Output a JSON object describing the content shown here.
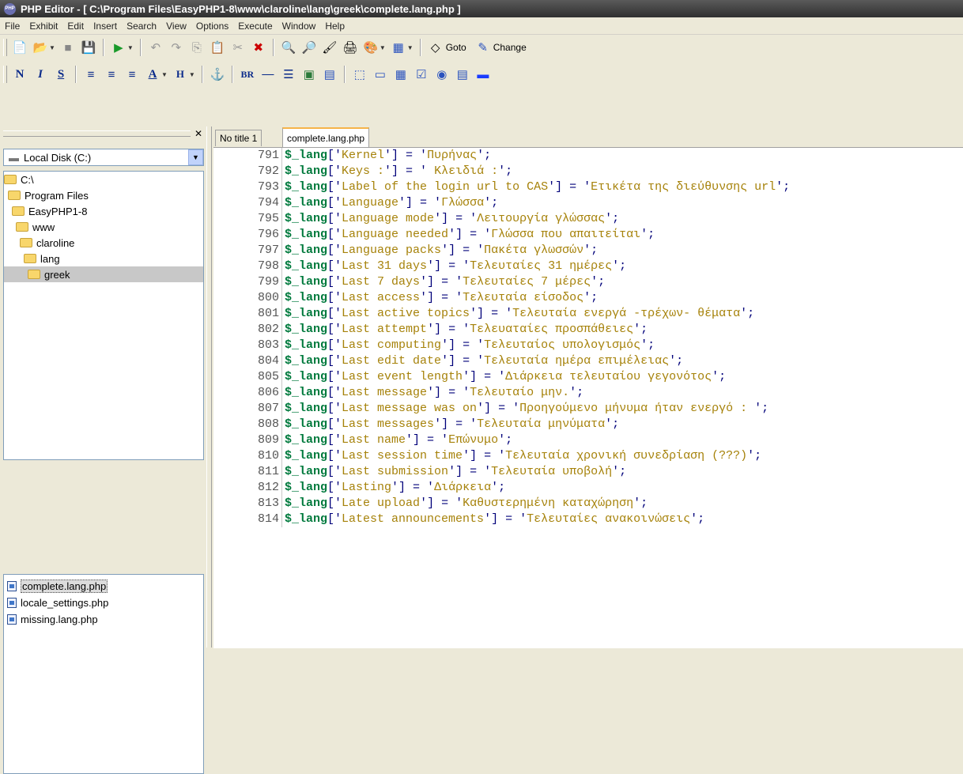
{
  "window": {
    "title": "PHP Editor - [ C:\\Program Files\\EasyPHP1-8\\www\\claroline\\lang\\greek\\complete.lang.php ]",
    "app_icon_text": "PHP"
  },
  "menu": [
    "File",
    "Exhibit",
    "Edit",
    "Insert",
    "Search",
    "View",
    "Options",
    "Execute",
    "Window",
    "Help"
  ],
  "toolbar": {
    "goto_label": "Goto",
    "change_label": "Change"
  },
  "format_toolbar": {
    "bold": "N",
    "italic": "I",
    "underline": "S",
    "color_letter": "A",
    "heading": "H",
    "br": "BR",
    "hr": "—"
  },
  "left_pane": {
    "drive": "Local Disk (C:)",
    "tree": [
      {
        "label": "C:\\"
      },
      {
        "label": "Program Files"
      },
      {
        "label": "EasyPHP1-8"
      },
      {
        "label": "www"
      },
      {
        "label": "claroline"
      },
      {
        "label": "lang"
      },
      {
        "label": "greek",
        "selected": true
      }
    ],
    "files": [
      {
        "label": "complete.lang.php",
        "selected": true
      },
      {
        "label": "locale_settings.php"
      },
      {
        "label": "missing.lang.php"
      }
    ]
  },
  "tabs": [
    {
      "label": "No title 1",
      "active": false
    },
    {
      "label": "complete.lang.php",
      "active": true
    }
  ],
  "editor": {
    "lines": [
      {
        "num": "791",
        "key": "Kernel",
        "value": "Πυρήνας"
      },
      {
        "num": "792",
        "key": "Keys :",
        "value": " Κλειδιά :"
      },
      {
        "num": "793",
        "key": "Label of the login url to CAS",
        "value": "Ετικέτα της διεύθυνσης url"
      },
      {
        "num": "794",
        "key": "Language",
        "value": "Γλώσσα"
      },
      {
        "num": "795",
        "key": "Language mode",
        "value": "Λειτουργία γλώσσας"
      },
      {
        "num": "796",
        "key": "Language needed",
        "value": "Γλώσσα που απαιτείται"
      },
      {
        "num": "797",
        "key": "Language packs",
        "value": "Πακέτα γλωσσών"
      },
      {
        "num": "798",
        "key": "Last 31 days",
        "value": "Τελευταίες 31 ημέρες"
      },
      {
        "num": "799",
        "key": "Last 7 days",
        "value": "Τελευταίες 7 μέρες"
      },
      {
        "num": "800",
        "key": "Last access",
        "value": "Τελευταία είσοδος"
      },
      {
        "num": "801",
        "key": "Last active topics",
        "value": "Τελευταία ενεργά -τρέχων- θέματα"
      },
      {
        "num": "802",
        "key": "Last attempt",
        "value": "Τελευαταίες προσπάθειες"
      },
      {
        "num": "803",
        "key": "Last computing",
        "value": "Τελευταίος υπολογισμός"
      },
      {
        "num": "804",
        "key": "Last edit date",
        "value": "Τελευταία ημέρα επιμέλειας"
      },
      {
        "num": "805",
        "key": "Last event length",
        "value": "Διάρκεια τελευταίου γεγονότος"
      },
      {
        "num": "806",
        "key": "Last message",
        "value": "Τελευταίο μην."
      },
      {
        "num": "807",
        "key": "Last message was on",
        "value": "Προηγούμενο μήνυμα ήταν ενεργό : "
      },
      {
        "num": "808",
        "key": "Last messages",
        "value": "Τελευταία μηνύματα"
      },
      {
        "num": "809",
        "key": "Last name",
        "value": "Επώνυμο"
      },
      {
        "num": "810",
        "key": "Last session time",
        "value": "Τελευταία χρονική συνεδρίαση (???)"
      },
      {
        "num": "811",
        "key": "Last submission",
        "value": "Τελευταία υποβολή"
      },
      {
        "num": "812",
        "key": "Lasting",
        "value": "Διάρκεια"
      },
      {
        "num": "813",
        "key": "Late upload",
        "value": "Καθυστερημένη καταχώρηση"
      },
      {
        "num": "814",
        "key": "Latest announcements",
        "value": "Τελευταίες ανακοινώσεις"
      }
    ]
  },
  "colors": {
    "titlebar": "#3a3a3a",
    "variable": "#007a3d",
    "string": "#a6820a",
    "punct": "#00007a",
    "active_tab_accent": "#f6b44a"
  }
}
